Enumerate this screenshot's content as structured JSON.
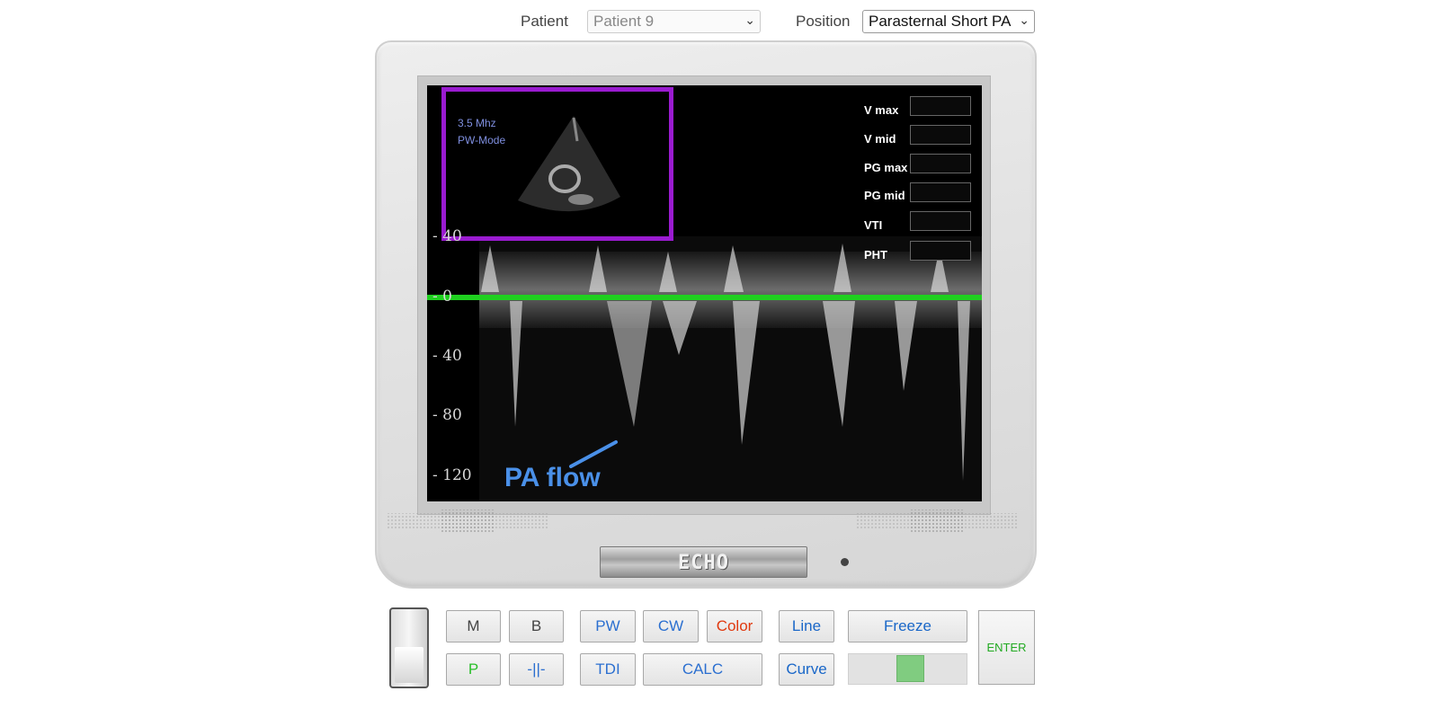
{
  "header": {
    "patient_label": "Patient",
    "patient_value": "Patient 9",
    "position_label": "Position",
    "position_value": "Parasternal Short PA"
  },
  "screen": {
    "frequency": "3.5 Mhz",
    "mode": "PW-Mode",
    "annotation": "PA flow",
    "measurements": [
      {
        "label": "V max",
        "value": ""
      },
      {
        "label": "V mid",
        "value": ""
      },
      {
        "label": "PG max",
        "value": ""
      },
      {
        "label": "PG mid",
        "value": ""
      },
      {
        "label": "VTI",
        "value": ""
      },
      {
        "label": "PHT",
        "value": ""
      }
    ],
    "velocity_ticks": [
      "40",
      "0",
      "40",
      "80",
      "120"
    ],
    "baseline_color": "#1fd01f",
    "inset_border_color": "#9a1bd0",
    "annotation_color": "#4a90e8"
  },
  "device": {
    "logo": "ECHO"
  },
  "controls": {
    "m": "M",
    "b": "B",
    "p": "P",
    "split": "-||-",
    "pw": "PW",
    "cw": "CW",
    "color": "Color",
    "tdi": "TDI",
    "calc": "CALC",
    "line": "Line",
    "curve": "Curve",
    "freeze": "Freeze",
    "enter": "ENTER",
    "gain_level": 0.45
  }
}
